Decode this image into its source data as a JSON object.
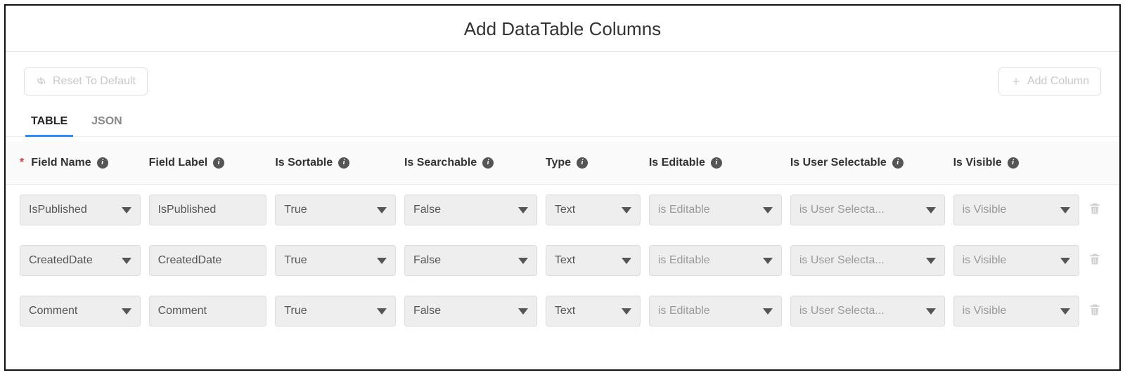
{
  "title": "Add DataTable Columns",
  "toolbar": {
    "reset_label": "Reset To Default",
    "add_label": "Add Column"
  },
  "tabs": [
    {
      "label": "TABLE",
      "active": true
    },
    {
      "label": "JSON",
      "active": false
    }
  ],
  "columns": {
    "field_name": {
      "label": "Field Name",
      "required": true
    },
    "field_label": {
      "label": "Field Label",
      "required": false
    },
    "is_sortable": {
      "label": "Is Sortable",
      "required": false
    },
    "is_searchable": {
      "label": "Is Searchable",
      "required": false
    },
    "type": {
      "label": "Type",
      "required": false
    },
    "is_editable": {
      "label": "Is Editable",
      "required": false
    },
    "is_user_sel": {
      "label": "Is User Selectable",
      "required": false
    },
    "is_visible": {
      "label": "Is Visible",
      "required": false
    }
  },
  "rows": [
    {
      "field_name": "IsPublished",
      "field_label": "IsPublished",
      "is_sortable": "True",
      "is_searchable": "False",
      "type": "Text",
      "is_editable": "is Editable",
      "is_user_sel": "is User Selecta...",
      "is_visible": "is Visible"
    },
    {
      "field_name": "CreatedDate",
      "field_label": "CreatedDate",
      "is_sortable": "True",
      "is_searchable": "False",
      "type": "Text",
      "is_editable": "is Editable",
      "is_user_sel": "is User Selecta...",
      "is_visible": "is Visible"
    },
    {
      "field_name": "Comment",
      "field_label": "Comment",
      "is_sortable": "True",
      "is_searchable": "False",
      "type": "Text",
      "is_editable": "is Editable",
      "is_user_sel": "is User Selecta...",
      "is_visible": "is Visible"
    }
  ]
}
